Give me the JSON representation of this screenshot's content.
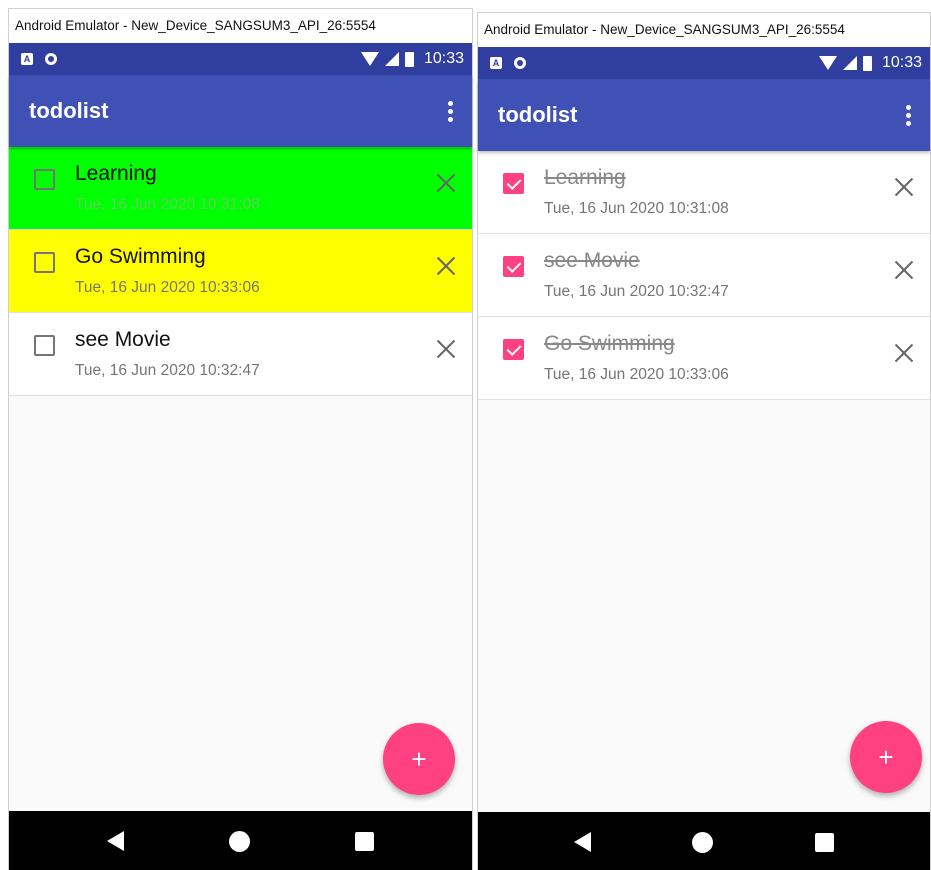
{
  "windows": [
    {
      "title": "Android Emulator - New_Device_SANGSUM3_API_26:5554",
      "status_time": "10:33",
      "app_title": "todolist",
      "items": [
        {
          "title": "Learning",
          "date": "Tue, 16 Jun 2020 10:31:08",
          "checked": false,
          "bg": "#00ff00"
        },
        {
          "title": "Go Swimming",
          "date": "Tue, 16 Jun 2020 10:33:06",
          "checked": false,
          "bg": "#ffff00"
        },
        {
          "title": "see Movie",
          "date": "Tue, 16 Jun 2020 10:32:47",
          "checked": false,
          "bg": "#ffffff"
        }
      ],
      "fab_label": "+"
    },
    {
      "title": "Android Emulator - New_Device_SANGSUM3_API_26:5554",
      "status_time": "10:33",
      "app_title": "todolist",
      "items": [
        {
          "title": "Learning",
          "date": "Tue, 16 Jun 2020 10:31:08",
          "checked": true,
          "bg": "#ffffff"
        },
        {
          "title": "see Movie",
          "date": "Tue, 16 Jun 2020 10:32:47",
          "checked": true,
          "bg": "#ffffff"
        },
        {
          "title": "Go Swimming",
          "date": "Tue, 16 Jun 2020 10:33:06",
          "checked": true,
          "bg": "#ffffff"
        }
      ],
      "fab_label": "+"
    }
  ],
  "colors": {
    "status_bar": "#303f9f",
    "app_bar": "#3f51b5",
    "accent": "#ff4081",
    "nav_bar": "#000000"
  },
  "icons": {
    "status": [
      "a-notification-icon",
      "circle-notification-icon",
      "wifi-icon",
      "signal-icon",
      "battery-icon"
    ],
    "nav": [
      "back-icon",
      "home-icon",
      "recents-icon"
    ],
    "row_action": "close-icon",
    "menu": "overflow-menu-icon",
    "fab": "add-icon"
  }
}
